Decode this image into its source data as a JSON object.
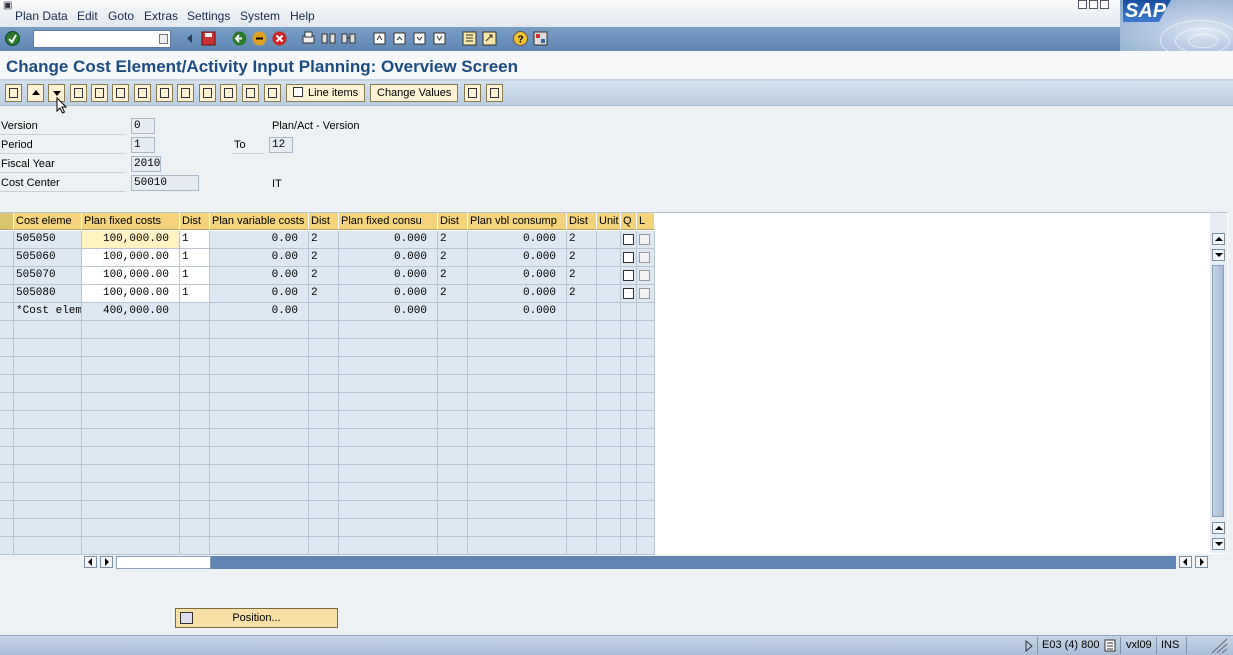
{
  "menu": [
    "Plan Data",
    "Edit",
    "Goto",
    "Extras",
    "Settings",
    "System",
    "Help"
  ],
  "sap_logo": "SAP",
  "title": "Change Cost Element/Activity Input Planning: Overview Screen",
  "toolbar": {
    "line_items": "Line items",
    "change_values": "Change Values"
  },
  "header": {
    "version_label": "Version",
    "version_value": "0",
    "version_desc": "Plan/Act - Version",
    "period_label": "Period",
    "period_from": "1",
    "to_label": "To",
    "period_to": "12",
    "fiscal_year_label": "Fiscal Year",
    "fiscal_year_value": "2010",
    "cost_center_label": "Cost Center",
    "cost_center_value": "50010",
    "cost_center_desc": "IT"
  },
  "table": {
    "columns": [
      "Cost eleme",
      "Plan fixed costs",
      "Dist",
      "Plan variable costs",
      "Dist",
      "Plan fixed consu",
      "Dist",
      "Plan vbl consump",
      "Dist",
      "Unit",
      "Q",
      "L"
    ],
    "rows": [
      [
        "505050",
        "100,000.00",
        "1",
        "0.00",
        "2",
        "0.000",
        "2",
        "0.000",
        "2"
      ],
      [
        "505060",
        "100,000.00",
        "1",
        "0.00",
        "2",
        "0.000",
        "2",
        "0.000",
        "2"
      ],
      [
        "505070",
        "100,000.00",
        "1",
        "0.00",
        "2",
        "0.000",
        "2",
        "0.000",
        "2"
      ],
      [
        "505080",
        "100,000.00",
        "1",
        "0.00",
        "2",
        "0.000",
        "2",
        "0.000",
        "2"
      ]
    ],
    "total_row": [
      "*Cost elem",
      "400,000.00",
      "",
      "0.00",
      "",
      "0.000",
      "",
      "0.000",
      ""
    ]
  },
  "position_button": "Position...",
  "status": {
    "system": "E03 (4) 800",
    "server": "vxl09",
    "mode": "INS"
  },
  "colors": {
    "title": "#1b4c82",
    "header_cell": "#f4d37c",
    "toolbar_blue": "#5f86b3"
  }
}
